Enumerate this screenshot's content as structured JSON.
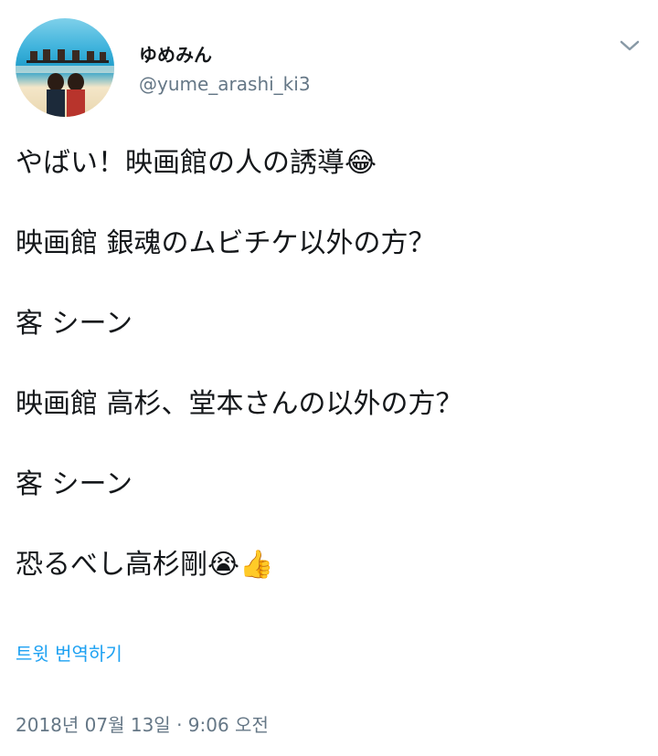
{
  "user": {
    "display_name": "ゆめみん",
    "handle": "@yume_arashi_ki3"
  },
  "menu_icon": "chevron-down-icon",
  "tweet": {
    "lines": [
      {
        "text": "やばい！映画館の人の誘導",
        "emoji": "😂"
      },
      {
        "text": "映画館 銀魂のムビチケ以外の方？",
        "emoji": ""
      },
      {
        "text": "客 シーン",
        "emoji": ""
      },
      {
        "text": "映画館 高杉、堂本さんの以外の方？",
        "emoji": ""
      },
      {
        "text": "客 シーン",
        "emoji": ""
      },
      {
        "text": "恐るべし高杉剛",
        "emoji": "😭👍"
      }
    ]
  },
  "translate_label": "트윗 번역하기",
  "timestamp": "2018년 07월 13일 · 9:06 오전",
  "colors": {
    "text": "#14171a",
    "secondary": "#657786",
    "link": "#1da1f2"
  }
}
